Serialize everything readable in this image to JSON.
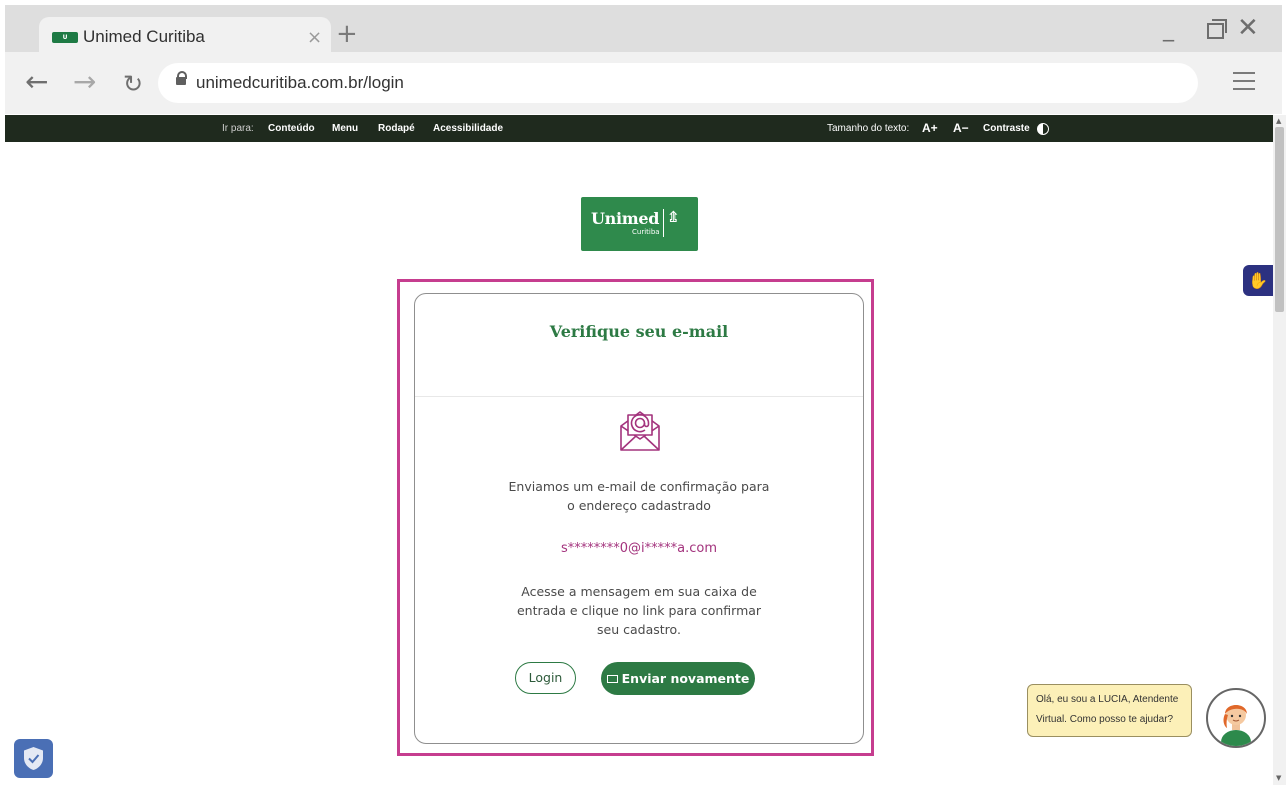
{
  "browser": {
    "tab_title": "Unimed Curitiba",
    "tab_close": "×",
    "new_tab": "+",
    "url": "unimedcuritiba.com.br/login"
  },
  "access_bar": {
    "goto_label": "Ir para:",
    "links": [
      "Conteúdo",
      "Menu",
      "Rodapé",
      "Acessibilidade"
    ],
    "text_size_label": "Tamanho do texto:",
    "increase": "A+",
    "decrease": "A−",
    "contrast": "Contraste"
  },
  "logo": {
    "name": "Unimed",
    "sub": "Curitiba"
  },
  "card": {
    "title": "Verifique seu e-mail",
    "line1": "Enviamos um e-mail de confirmação para",
    "line2": "o endereço cadastrado",
    "email": "s********0@i*****a.com",
    "line3": "Acesse a mensagem em sua caixa de",
    "line4": "entrada e clique no link para confirmar",
    "line5": "seu cadastro.",
    "login_button": "Login",
    "resend_button": "Enviar novamente"
  },
  "chat": {
    "line1": "Olá, eu sou a LUCIA, Atendente",
    "line2": "Virtual. Como posso te ajudar?"
  },
  "colors": {
    "brand_green": "#2d7a44",
    "highlight_magenta": "#c63d8f",
    "email_purple": "#a3337d",
    "access_bar_bg": "#1f2a1e"
  },
  "icons": [
    "lock-icon",
    "mail-at-icon",
    "envelope-icon",
    "sign-language-icon",
    "shield-icon",
    "chat-avatar-icon"
  ]
}
